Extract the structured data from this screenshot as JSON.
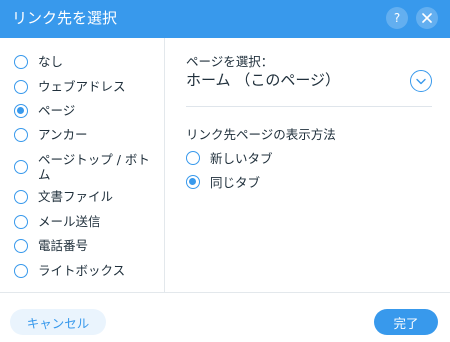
{
  "colors": {
    "accent": "#3899ec",
    "cancel_bg": "#eaf4fd",
    "text": "#20303c"
  },
  "header": {
    "title": "リンク先を選択",
    "help_label": "?",
    "help_icon": "question-mark",
    "close_icon": "close-x"
  },
  "link_types": [
    {
      "label": "なし",
      "selected": false
    },
    {
      "label": "ウェブアドレス",
      "selected": false
    },
    {
      "label": "ページ",
      "selected": true
    },
    {
      "label": "アンカー",
      "selected": false
    },
    {
      "label": "ページトップ / ボトム",
      "selected": false
    },
    {
      "label": "文書ファイル",
      "selected": false
    },
    {
      "label": "メール送信",
      "selected": false
    },
    {
      "label": "電話番号",
      "selected": false
    },
    {
      "label": "ライトボックス",
      "selected": false
    }
  ],
  "page_select": {
    "label": "ページを選択：",
    "value": "ホーム （このページ）",
    "dropdown_icon": "chevron-down"
  },
  "open_method": {
    "label": "リンク先ページの表示方法",
    "options": [
      {
        "label": "新しいタブ",
        "selected": false
      },
      {
        "label": "同じタブ",
        "selected": true
      }
    ]
  },
  "footer": {
    "cancel_label": "キャンセル",
    "done_label": "完了"
  }
}
